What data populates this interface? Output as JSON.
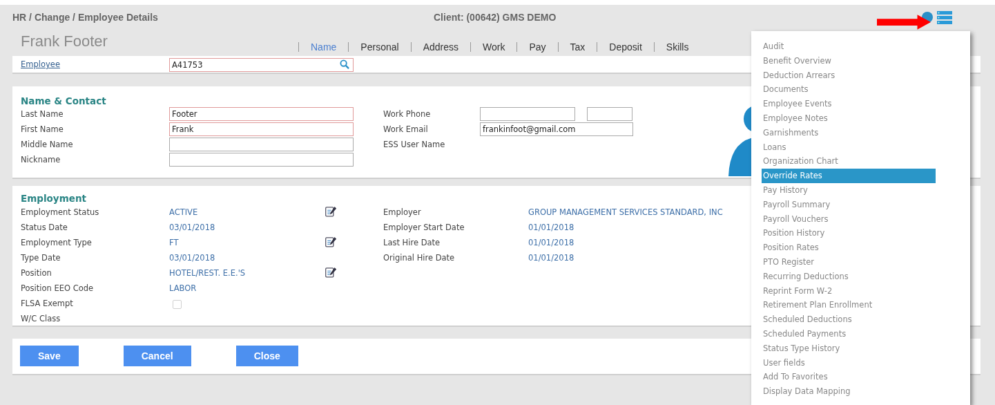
{
  "header": {
    "breadcrumb": "HR / Change / Employee Details",
    "client": "Client: (00642) GMS DEMO"
  },
  "employee_name": "Frank Footer",
  "tabs": [
    {
      "label": "Name",
      "selected": true
    },
    {
      "label": "Personal",
      "selected": false
    },
    {
      "label": "Address",
      "selected": false
    },
    {
      "label": "Work",
      "selected": false
    },
    {
      "label": "Pay",
      "selected": false
    },
    {
      "label": "Tax",
      "selected": false
    },
    {
      "label": "Deposit",
      "selected": false
    },
    {
      "label": "Skills",
      "selected": false
    }
  ],
  "employee_lookup": {
    "label": "Employee",
    "value": "A41753",
    "required": true
  },
  "name_contact": {
    "title": "Name & Contact",
    "fields": [
      {
        "label": "Last Name",
        "value": "Footer",
        "required": true
      },
      {
        "label": "First Name",
        "value": "Frank",
        "required": true
      },
      {
        "label": "Middle Name",
        "required": false
      },
      {
        "label": "Nickname",
        "required": false
      }
    ],
    "contact_fields": [
      {
        "label": "Work Phone",
        "kind": "phone"
      },
      {
        "label": "Work Email",
        "kind": "text",
        "value": "frankinfoot@gmail.com"
      },
      {
        "label": "ESS User Name",
        "kind": "none"
      }
    ]
  },
  "employment": {
    "title": "Employment",
    "fields": [
      {
        "label": "Employment Status",
        "kind": "text",
        "value": "ACTIVE",
        "editable": true
      },
      {
        "label": "Status Date",
        "kind": "text",
        "value": "03/01/2018",
        "editable": false
      },
      {
        "label": "Employment Type",
        "kind": "text",
        "value": "FT",
        "editable": true
      },
      {
        "label": "Type Date",
        "kind": "text",
        "value": "03/01/2018",
        "editable": false
      },
      {
        "label": "Position",
        "kind": "text",
        "value": "HOTEL/REST. E.E.'S",
        "editable": true
      },
      {
        "label": "Position EEO Code",
        "kind": "text",
        "value": "LABOR",
        "editable": false
      },
      {
        "label": "FLSA Exempt",
        "kind": "checkbox",
        "checked": false,
        "disabled": true,
        "editable": false
      },
      {
        "label": "W/C Class",
        "kind": "none",
        "editable": false
      }
    ],
    "employer_fields": [
      {
        "label": "Employer",
        "value": "GROUP MANAGEMENT SERVICES STANDARD, INC"
      },
      {
        "label": "Employer Start Date",
        "value": "01/01/2018"
      },
      {
        "label": "Last Hire Date",
        "value": "01/01/2018"
      },
      {
        "label": "Original Hire Date",
        "value": "01/01/2018"
      }
    ]
  },
  "buttons": [
    "Save",
    "Cancel",
    "Close"
  ],
  "menu": [
    {
      "label": "Audit",
      "selected": false
    },
    {
      "label": "Benefit Overview",
      "selected": false
    },
    {
      "label": "Deduction Arrears",
      "selected": false
    },
    {
      "label": "Documents",
      "selected": false
    },
    {
      "label": "Employee Events",
      "selected": false
    },
    {
      "label": "Employee Notes",
      "selected": false
    },
    {
      "label": "Garnishments",
      "selected": false
    },
    {
      "label": "Loans",
      "selected": false
    },
    {
      "label": "Organization Chart",
      "selected": false
    },
    {
      "label": "Override Rates",
      "selected": true
    },
    {
      "label": "Pay History",
      "selected": false
    },
    {
      "label": "Payroll Summary",
      "selected": false
    },
    {
      "label": "Payroll Vouchers",
      "selected": false
    },
    {
      "label": "Position History",
      "selected": false
    },
    {
      "label": "Position Rates",
      "selected": false
    },
    {
      "label": "PTO Register",
      "selected": false
    },
    {
      "label": "Recurring Deductions",
      "selected": false
    },
    {
      "label": "Reprint Form W-2",
      "selected": false
    },
    {
      "label": "Retirement Plan Enrollment",
      "selected": false
    },
    {
      "label": "Scheduled Deductions",
      "selected": false
    },
    {
      "label": "Scheduled Payments",
      "selected": false
    },
    {
      "label": "Status Type History",
      "selected": false
    },
    {
      "label": "User fields",
      "selected": false
    },
    {
      "label": "Add To Favorites",
      "selected": false
    },
    {
      "label": "Display Data Mapping",
      "selected": false
    }
  ]
}
